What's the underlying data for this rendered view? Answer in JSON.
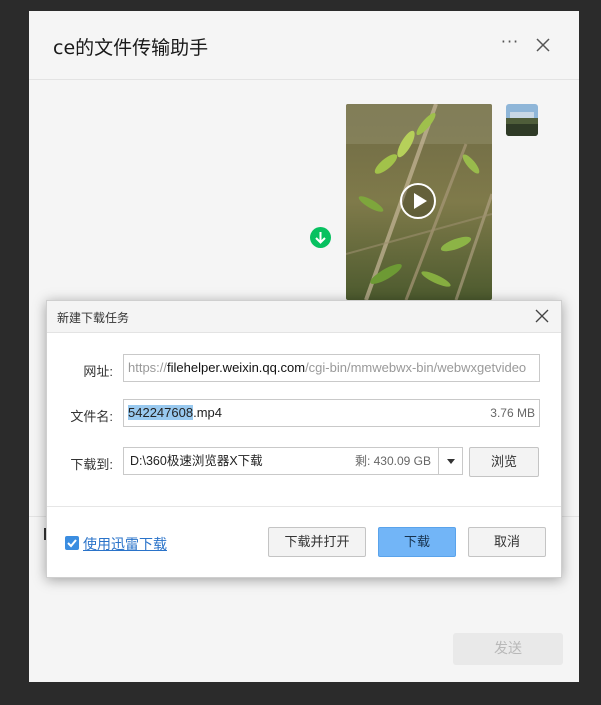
{
  "chat": {
    "title": "ce的文件传输助手",
    "more_label": "···",
    "send_label": "发送"
  },
  "dialog": {
    "title": "新建下载任务",
    "url_label": "网址:",
    "url_prefix": "https://",
    "url_host": "filehelper.weixin.qq.com",
    "url_path": "/cgi-bin/mmwebwx-bin/webwxgetvideo",
    "filename_label": "文件名:",
    "filename_selected": "542247608",
    "filename_ext": ".mp4",
    "file_size": "3.76 MB",
    "saveto_label": "下载到:",
    "save_path": "D:\\360极速浏览器X下载",
    "free_space": "剩: 430.09 GB",
    "browse_label": "浏览",
    "xunlei_label": "使用迅雷下载",
    "open_after_label": "下载并打开",
    "download_label": "下载",
    "cancel_label": "取消"
  },
  "colors": {
    "accent_green": "#07c160",
    "primary_button": "#72b5f7",
    "link_blue": "#2a73c9",
    "selection": "#99c9ef"
  }
}
